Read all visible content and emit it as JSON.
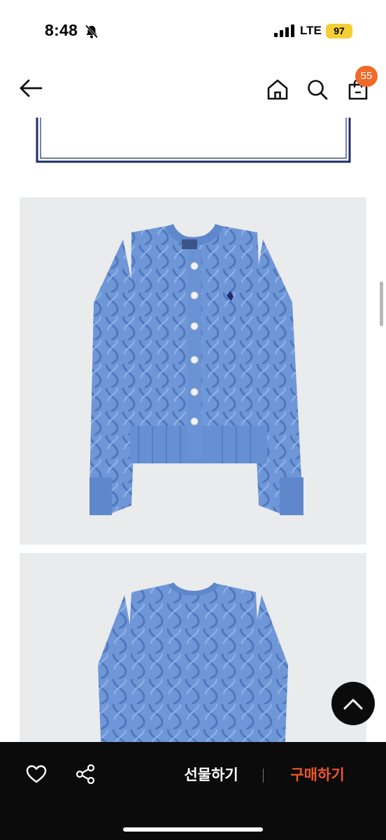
{
  "status_bar": {
    "time": "8:48",
    "network": "LTE",
    "battery": "97"
  },
  "header": {
    "cart_count": "55",
    "icons": [
      "back-arrow-icon",
      "home-icon",
      "search-icon",
      "shopping-bag-icon"
    ]
  },
  "product_images": [
    {
      "subject": "blue-cable-knit-cardigan-front-photo"
    },
    {
      "subject": "blue-cable-knit-cardigan-back-photo"
    }
  ],
  "bottom_bar": {
    "gift_label": "선물하기",
    "buy_label": "구매하기",
    "icons": [
      "heart-icon",
      "share-icon"
    ]
  },
  "colors": {
    "accent": "#f0562a",
    "badge": "#f06a2a",
    "bar_background": "#0b0b0b",
    "battery": "#f4cf33",
    "sweater_blue": "#6f97d8",
    "frame_navy": "#1d2d6b"
  }
}
